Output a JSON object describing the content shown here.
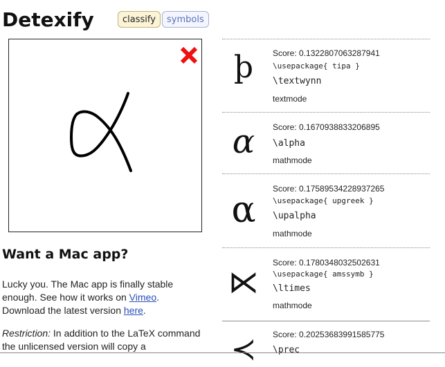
{
  "header": {
    "logo": "Detexify",
    "nav": {
      "classify": "classify",
      "symbols": "symbols"
    }
  },
  "canvas": {
    "clear_icon": "close-x-icon",
    "clear_color": "#ee1111",
    "stroke_color": "#000000"
  },
  "mac": {
    "title": "Want a Mac app?",
    "para_1": "Lucky you. The Mac app is finally stable enough. See how it works on ",
    "vimeo_link": "Vimeo",
    "para_2": ". Download the latest version ",
    "here_link": "here",
    "para_3": ".",
    "restriction_label": "Restriction:",
    "restriction_text": " In addition to the LaTeX command the unlicensed version will copy a"
  },
  "results": [
    {
      "glyph": "þ",
      "score": "Score: 0.1322807063287941",
      "package": "\\usepackage{ tipa }",
      "command": "\\textwynn",
      "mode": "textmode"
    },
    {
      "glyph": "α",
      "score": "Score: 0.1670938833206895",
      "package": "",
      "command": "\\alpha",
      "mode": "mathmode"
    },
    {
      "glyph": "α",
      "score": "Score: 0.17589534228937265",
      "package": "\\usepackage{ upgreek }",
      "command": "\\upalpha",
      "mode": "mathmode"
    },
    {
      "glyph": "⋉",
      "score": "Score: 0.1780348032502631",
      "package": "\\usepackage{ amssymb }",
      "command": "\\ltimes",
      "mode": "mathmode"
    },
    {
      "glyph": "≺",
      "score": "Score: 0.20253683991585775",
      "package": "",
      "command": "\\prec",
      "mode": ""
    }
  ]
}
